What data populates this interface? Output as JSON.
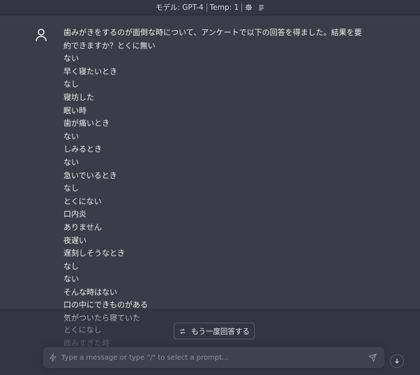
{
  "topbar": {
    "model_label": "モデル: GPT-4",
    "temp_label": "Temp: 1"
  },
  "message": {
    "prompt_text": "歯みがきをするのが面倒な時について、アンケートで以下の回答を得ました。結果を要約できますか？とくに無い",
    "answers": [
      "ない",
      "早く寝たいとき",
      "なし",
      "寝坊した",
      "眠い時",
      "歯が痛いとき",
      "ない",
      "しみるとき",
      "ない",
      "急いでいるとき",
      "なし",
      "とくにない",
      "口内炎",
      "ありません",
      "夜遅い",
      "遅刻しそうなとき",
      "なし",
      "ない",
      "そんな時はない",
      "口の中にできものがある",
      "気がついたら寝ていた"
    ],
    "faded_answers": [
      "とくになし",
      "飲みすぎた時"
    ]
  },
  "regenerate": {
    "label": "もう一度回答する"
  },
  "input": {
    "placeholder": "Type a message or type \"/\" to select a prompt..."
  },
  "icons": {
    "settings": "gear-icon",
    "menu": "lines-icon",
    "avatar": "user-icon",
    "regenerate": "refresh-icon",
    "prompt": "lightning-icon",
    "send": "paper-plane-icon",
    "scroll": "arrow-down-icon"
  }
}
